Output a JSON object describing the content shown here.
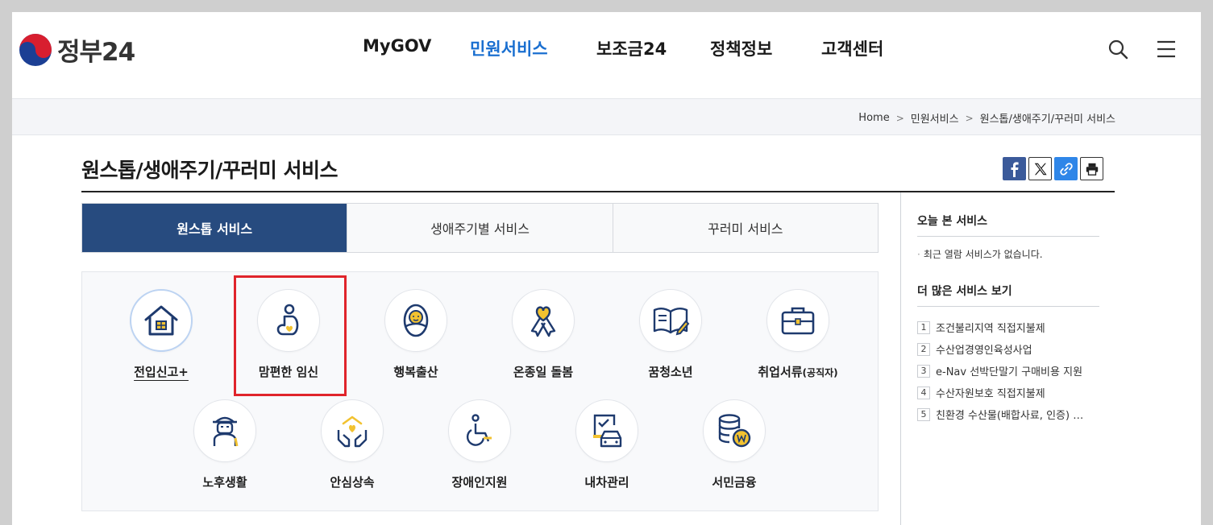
{
  "header": {
    "logo_text": "정부24",
    "nav": [
      "MyGOV",
      "민원서비스",
      "보조금24",
      "정책정보",
      "고객센터"
    ],
    "active_nav": "민원서비스"
  },
  "breadcrumb": [
    "Home",
    "민원서비스",
    "원스톱/생애주기/꾸러미 서비스"
  ],
  "page_title": "원스톱/생애주기/꾸러미 서비스",
  "tabs": [
    {
      "label": "원스톱 서비스",
      "active": true
    },
    {
      "label": "생애주기별 서비스",
      "active": false
    },
    {
      "label": "꾸러미 서비스",
      "active": false
    }
  ],
  "services_row1": [
    {
      "label": "전입신고+",
      "icon": "house-icon"
    },
    {
      "label": "맘편한 임신",
      "icon": "pregnancy-icon"
    },
    {
      "label": "행복출산",
      "icon": "baby-icon"
    },
    {
      "label": "온종일 돌봄",
      "icon": "ribbon-heart-icon"
    },
    {
      "label": "꿈청소년",
      "icon": "book-pencil-icon"
    },
    {
      "label": "취업서류",
      "label_small": "(공직자)",
      "icon": "briefcase-icon"
    }
  ],
  "services_row2": [
    {
      "label": "노후생활",
      "icon": "elder-icon"
    },
    {
      "label": "안심상속",
      "icon": "hands-heart-icon"
    },
    {
      "label": "장애인지원",
      "icon": "wheelchair-icon"
    },
    {
      "label": "내차관리",
      "icon": "car-document-icon"
    },
    {
      "label": "서민금융",
      "icon": "coins-icon"
    }
  ],
  "sidebar": {
    "recent_title": "오늘 본 서비스",
    "recent_empty": "최근 열람 서비스가 없습니다.",
    "more_title": "더 많은 서비스 보기",
    "more_items": [
      {
        "num": "1",
        "label": "조건불리지역 직접지불제"
      },
      {
        "num": "2",
        "label": "수산업경영인육성사업"
      },
      {
        "num": "3",
        "label": "e-Nav 선박단말기 구매비용 지원"
      },
      {
        "num": "4",
        "label": "수산자원보호 직접지불제"
      },
      {
        "num": "5",
        "label": "친환경 수산물(배합사료, 인증) …"
      }
    ]
  },
  "colors": {
    "accent_blue": "#1a6fd0",
    "tab_active": "#274b7f",
    "icon_navy": "#1e3a6e",
    "icon_yellow": "#f2c230",
    "highlight_red": "#e0242b"
  }
}
